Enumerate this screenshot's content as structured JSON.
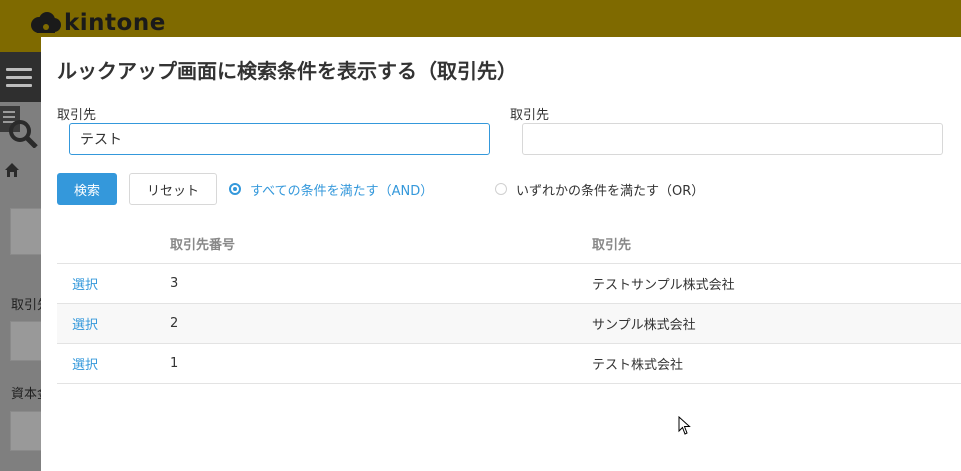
{
  "brand": {
    "name": "kintone",
    "bar_color": "#7f6a00"
  },
  "background": {
    "labels": [
      "取引先",
      "資本金"
    ]
  },
  "dialog": {
    "title": "ルックアップ画面に検索条件を表示する（取引先）",
    "fields": [
      {
        "label": "取引先",
        "value": "テスト",
        "placeholder": ""
      },
      {
        "label": "取引先",
        "value": "",
        "placeholder": ""
      }
    ],
    "buttons": {
      "search": "検索",
      "reset": "リセット"
    },
    "conditions": [
      {
        "label": "すべての条件を満たす（AND）",
        "checked": true
      },
      {
        "label": "いずれかの条件を満たす（OR）",
        "checked": false
      }
    ],
    "table": {
      "headers": [
        "",
        "取引先番号",
        "取引先"
      ],
      "rows": [
        {
          "action": "選択",
          "number": "3",
          "name": "テストサンプル株式会社"
        },
        {
          "action": "選択",
          "number": "2",
          "name": "サンプル株式会社"
        },
        {
          "action": "選択",
          "number": "1",
          "name": "テスト株式会社"
        }
      ]
    }
  },
  "colors": {
    "accent": "#3498db",
    "overlay": "#7f7f7f",
    "text": "#333333",
    "header_text": "#888888"
  }
}
